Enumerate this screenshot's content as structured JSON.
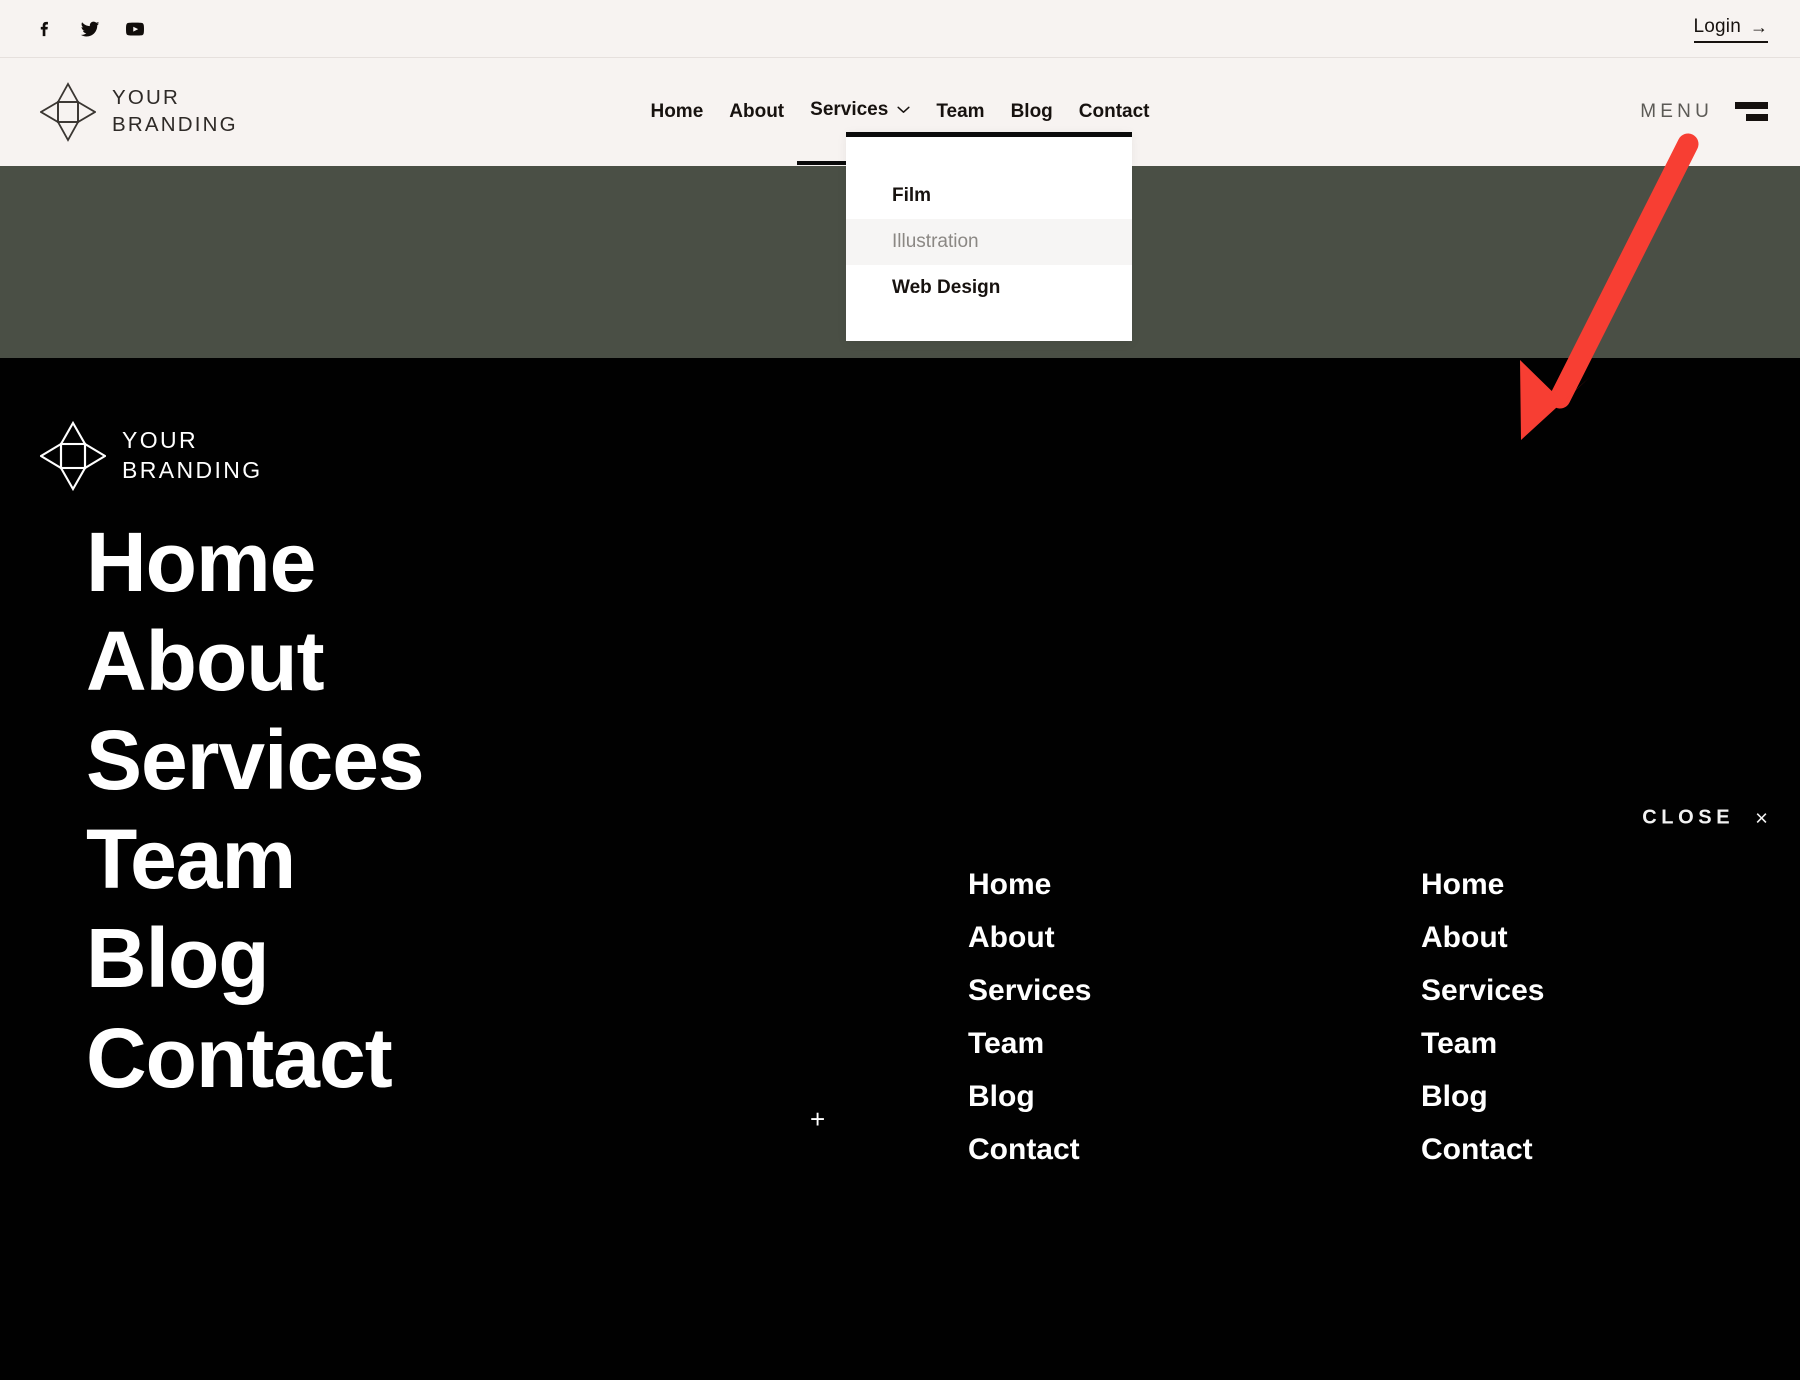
{
  "colors": {
    "header_bg": "#F7F3F1",
    "olive_band": "#4A4F45",
    "overlay_bg": "#010101",
    "accent_text": "#17120F",
    "annotation_red": "#F73E33",
    "dropdown_bg": "#FFFFFF",
    "dropdown_active_bg": "#F6F5F4",
    "dropdown_active_text": "#8B8884"
  },
  "topbar": {
    "social": [
      {
        "name": "facebook-icon",
        "label": "Facebook"
      },
      {
        "name": "twitter-icon",
        "label": "Twitter"
      },
      {
        "name": "youtube-icon",
        "label": "YouTube"
      }
    ],
    "login_label": "Login",
    "login_arrow": "→"
  },
  "brand": {
    "logo_name": "your-branding-logo",
    "text": "YOUR\nBRANDING"
  },
  "nav": {
    "items": [
      {
        "label": "Home",
        "has_dropdown": false
      },
      {
        "label": "About",
        "has_dropdown": false
      },
      {
        "label": "Services",
        "has_dropdown": true
      },
      {
        "label": "Team",
        "has_dropdown": false
      },
      {
        "label": "Blog",
        "has_dropdown": false
      },
      {
        "label": "Contact",
        "has_dropdown": false
      }
    ]
  },
  "menu_toggle": {
    "label": "MENU",
    "icon": "hamburger-icon"
  },
  "dropdown": {
    "open_for": "Services",
    "items": [
      {
        "label": "Film",
        "active": false
      },
      {
        "label": "Illustration",
        "active": true
      },
      {
        "label": "Web Design",
        "active": false
      }
    ]
  },
  "overlay": {
    "brand_text": "YOUR\nBRANDING",
    "close_label": "CLOSE",
    "close_icon": "×",
    "plus_icon": "+",
    "primary_links": [
      "Home",
      "About",
      "Services",
      "Team",
      "Blog",
      "Contact"
    ],
    "column_two_links": [
      "Home",
      "About",
      "Services",
      "Team",
      "Blog",
      "Contact"
    ],
    "column_three_links": [
      "Home",
      "About",
      "Services",
      "Team",
      "Blog",
      "Contact"
    ]
  },
  "annotation": {
    "name": "red-pointer-arrow",
    "points_to": "MENU"
  }
}
